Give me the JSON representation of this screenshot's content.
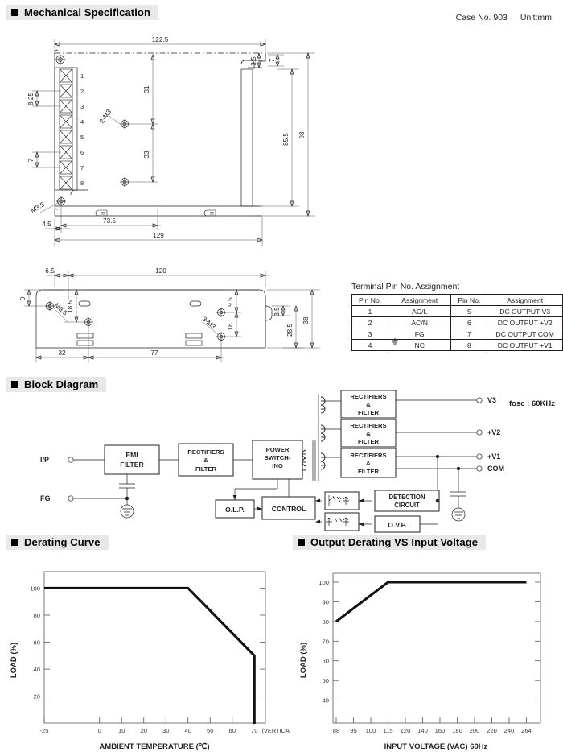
{
  "sections": {
    "mechanical": "Mechanical Specification",
    "block": "Block Diagram",
    "derating": "Derating Curve",
    "output_derating": "Output Deratinɡ VS Input Voltage"
  },
  "topnote": {
    "case_no": "Case No. 903",
    "unit": "Unit:mm"
  },
  "mechanical": {
    "top_view_dims": {
      "width_total": "122.5",
      "pin_spacing_a": "8.25",
      "pin_spacing_b": "7",
      "mount_31": "31",
      "mount_33": "33",
      "screw_2m3": "2-M3",
      "height_85_5": "85.5",
      "height_98": "98",
      "notch_3_5": "3.5",
      "notch_7": "7",
      "offset_4_5": "4.5",
      "len_73_5": "73.5",
      "len_129": "129",
      "screw_m3_5": "M3.5",
      "pins": [
        "1",
        "2",
        "3",
        "4",
        "5",
        "6",
        "7",
        "8"
      ]
    },
    "side_view_dims": {
      "edge_6_5": "6.5",
      "len_120": "120",
      "height_9": "9",
      "screw_m3_5": "M3.5",
      "height_18_5": "18.5",
      "height_9_5": "9.5",
      "height_18": "18",
      "screw_3m3": "3-M3",
      "notch_3_5": "3.5",
      "height_28_5": "28.5",
      "height_38": "38",
      "len_32": "32",
      "len_77": "77"
    }
  },
  "terminal_table": {
    "title": "Terminal Pin No.  Assignment",
    "headers": [
      "Pin No.",
      "Assignment",
      "Pin No.",
      "Assignment"
    ],
    "rows": [
      [
        "1",
        "AC/L",
        "5",
        "DC OUTPUT V3"
      ],
      [
        "2",
        "AC/N",
        "6",
        "DC OUTPUT +V2"
      ],
      [
        "3",
        "FG",
        "7",
        "DC OUTPUT COM"
      ],
      [
        "4",
        "NC",
        "8",
        "DC OUTPUT +V1"
      ]
    ]
  },
  "block_diagram": {
    "inputs": [
      "I/P",
      "FG"
    ],
    "blocks": {
      "emi": [
        "EMI",
        "FILTER"
      ],
      "rect_in": [
        "RECTIFIERS",
        "&",
        "FILTER"
      ],
      "power_switching": [
        "POWER",
        "SWITCH-",
        "ING"
      ],
      "rect_v3": [
        "RECTIFIERS",
        "&",
        "FILTER"
      ],
      "rect_v2": [
        "RECTIFIERS",
        "&",
        "FILTER"
      ],
      "rect_v1": [
        "RECTIFIERS",
        "&",
        "FILTER"
      ],
      "olp": "O.L.P.",
      "control": "CONTROL",
      "detection": [
        "DETECTION",
        "CIRCUIT"
      ],
      "ovp": "O.V.P."
    },
    "outputs": [
      "V3",
      "+V2",
      "+V1",
      "COM"
    ],
    "fosc": "fosc : 60KHz"
  },
  "chart_data": [
    {
      "type": "line",
      "title": "Derating Curve",
      "xlabel": "AMBIENT TEMPERATURE (℃)",
      "ylabel": "LOAD (%)",
      "xticks": [
        "-25",
        "0",
        "10",
        "20",
        "30",
        "40",
        "50",
        "60",
        "70"
      ],
      "xtickvals": [
        -25,
        0,
        10,
        20,
        30,
        40,
        50,
        60,
        70
      ],
      "yticks": [
        "20",
        "40",
        "60",
        "80",
        "100"
      ],
      "ytickvals": [
        20,
        40,
        60,
        80,
        100
      ],
      "xlim": [
        -25,
        75
      ],
      "ylim": [
        0,
        112
      ],
      "annotation": "(VERTICAL)",
      "grid": false,
      "series": [
        {
          "name": "derating",
          "x": [
            -25,
            40,
            70,
            70
          ],
          "values": [
            100,
            100,
            50,
            0
          ]
        }
      ]
    },
    {
      "type": "line",
      "title": "Output Derating VS Input Voltage",
      "xlabel": "INPUT VOLTAGE (VAC) 60Hz",
      "ylabel": "LOAD (%)",
      "xticks": [
        "88",
        "95",
        "100",
        "115",
        "120",
        "140",
        "160",
        "180",
        "200",
        "220",
        "240",
        "264"
      ],
      "yticks": [
        "40",
        "50",
        "60",
        "70",
        "80",
        "90",
        "100"
      ],
      "ytickvals": [
        40,
        50,
        60,
        70,
        80,
        90,
        100
      ],
      "ylim": [
        30,
        106
      ],
      "grid": false,
      "series": [
        {
          "name": "output-derating",
          "x": [
            "88",
            "115",
            "264"
          ],
          "values": [
            80,
            100,
            100
          ]
        }
      ]
    }
  ]
}
